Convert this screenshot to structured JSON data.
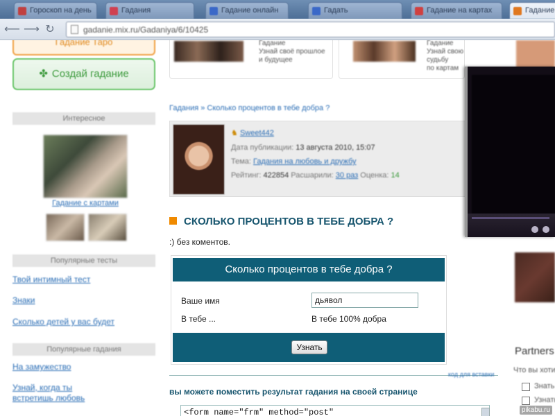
{
  "browser": {
    "tabs": [
      {
        "label": "Гороскоп на день",
        "color": "#c04040"
      },
      {
        "label": "Гадания",
        "color": "#d04050"
      },
      {
        "label": "Гадание онлайн",
        "color": "#3a68c8"
      },
      {
        "label": "Гадать",
        "color": "#3a68c8"
      },
      {
        "label": "Гадание на картах",
        "color": "#d04040"
      },
      {
        "label": "Гадание",
        "color": "#e07820"
      }
    ],
    "url": "gadanie.mix.ru/Gadaniya/6/10425"
  },
  "sidebar": {
    "top_button": "Гадание Таро",
    "create_button": "Создай гадание",
    "interesting_heading": "Интересное",
    "interesting_caption": "Гадание с картами",
    "popular_tests_heading": "Популярные тесты",
    "popular_tests": [
      "Твой интимный тест",
      "Знаки",
      "Сколько детей у вас будет"
    ],
    "popular_gadaniya_heading": "Популярные гадания",
    "popular_gadaniya": [
      "На замужество",
      "Узнай, когда ты",
      "встретишь любовь"
    ]
  },
  "cards": [
    {
      "line1": "Гадание",
      "line2": "Узнай своё прошлое",
      "line3": "и будущее"
    },
    {
      "line1": "Гадание",
      "line2": "Узнай свою судьбу",
      "line3": "по картам"
    }
  ],
  "breadcrumb": "Гадания » Сколько процентов в тебе добра ?",
  "author": {
    "name": "Sweet442",
    "date_label": "Дата публикации:",
    "date_value": "13 августа 2010, 15:07",
    "theme_label": "Тема:",
    "theme_value": "Гадания на любовь и дружбу",
    "rating_label": "Рейтинг:",
    "rating_value": "422854",
    "passed_label": "Расшарили:",
    "passed_value": "30 раз",
    "score_label": "Оценка:",
    "score_value": "14"
  },
  "gadanie": {
    "title": "СКОЛЬКО ПРОЦЕНТОВ В ТЕБЕ ДОБРА ?",
    "comment": ":) без коментов.",
    "form_title": "Сколько процентов в тебе добра ?",
    "name_label": "Ваше имя",
    "name_value": "дьявол",
    "result_label": "В тебе ...",
    "result_value": "В тебе 100% добра",
    "submit_label": "Узнать"
  },
  "embed": {
    "title": "вы можете поместить результат гадания на своей странице",
    "code": "<form name=\"frm\" method=\"post\"",
    "note": "код для вставки"
  },
  "right_column": {
    "heading": "Partners",
    "line1": "Что вы хотите",
    "option1": "Знать",
    "option2": "Узнать"
  },
  "watermark": "pikabu.ru",
  "colors": {
    "accent_teal": "#0f5e77",
    "title_teal": "#17556e",
    "orange_marker": "#f08a00",
    "link_blue": "#2a6db5",
    "green_button": "#3c9a3c"
  }
}
